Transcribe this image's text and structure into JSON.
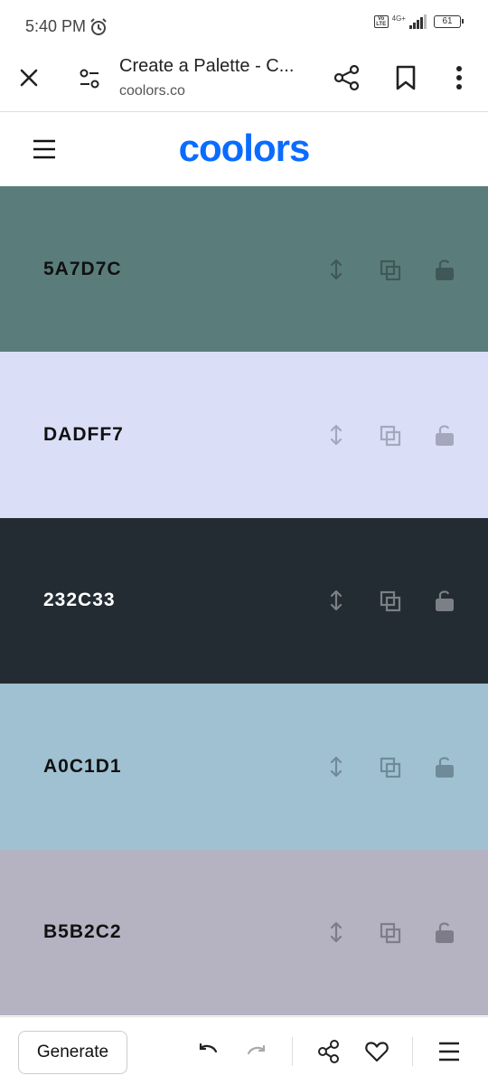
{
  "status_bar": {
    "time": "5:40 PM",
    "volte": "Vo LTE",
    "network": "4G+",
    "battery": "61"
  },
  "browser": {
    "title": "Create a Palette - C...",
    "url": "coolors.co"
  },
  "site": {
    "logo": "coolors"
  },
  "palette": [
    {
      "hex": "5A7D7C",
      "bg": "#5A7D7C",
      "fg": "#111111",
      "icon": "#3f5857"
    },
    {
      "hex": "DADFF7",
      "bg": "#DADFF7",
      "fg": "#111111",
      "icon": "#a4a8bd"
    },
    {
      "hex": "232C33",
      "bg": "#232C33",
      "fg": "#ffffff",
      "icon": "#7a8086"
    },
    {
      "hex": "A0C1D1",
      "bg": "#A0C1D1",
      "fg": "#111111",
      "icon": "#6f8b99"
    },
    {
      "hex": "B5B2C2",
      "bg": "#B5B2C2",
      "fg": "#111111",
      "icon": "#7e7c89"
    }
  ],
  "bottom_bar": {
    "generate_label": "Generate"
  },
  "colors": {
    "brand": "#0A6CFF"
  }
}
